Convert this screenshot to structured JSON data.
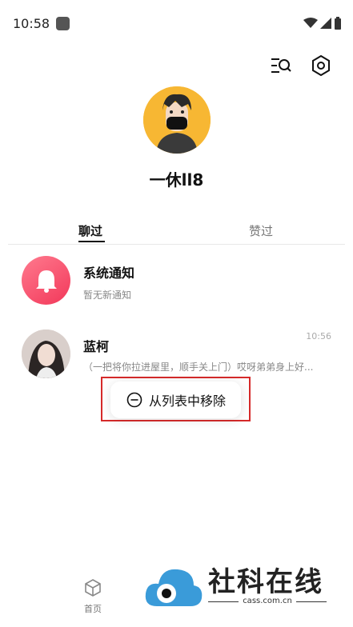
{
  "status_bar": {
    "time": "10:58"
  },
  "profile": {
    "username": "一休ll8"
  },
  "tabs": [
    {
      "label": "聊过",
      "active": true
    },
    {
      "label": "赞过",
      "active": false
    }
  ],
  "conversations": [
    {
      "title": "系统通知",
      "subtitle": "暂无新通知",
      "time": ""
    },
    {
      "title": "蓝柯",
      "subtitle": "（一把将你拉进屋里，顺手关上门）哎呀弟弟身上好...",
      "time": "10:56"
    }
  ],
  "context_menu": {
    "label": "从列表中移除",
    "icon": "minus-circle-icon"
  },
  "bottom_nav": {
    "home_label": "首页"
  },
  "watermark": {
    "title": "社科在线",
    "sub": "cass.com.cn"
  },
  "colors": {
    "accent_red": "#d62a2a",
    "notification_gradient": "#f2385a",
    "avatar_bg": "#f7b733"
  }
}
